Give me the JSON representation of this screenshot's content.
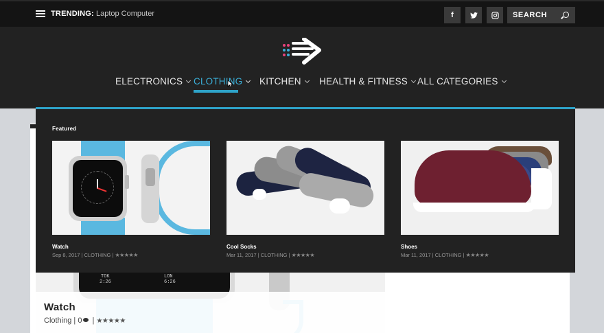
{
  "topbar": {
    "trending_label": "TRENDING:",
    "trending_value": "Laptop Computer",
    "social": [
      "f",
      "t",
      "i"
    ],
    "search_placeholder": "SEARCH"
  },
  "nav": {
    "items": [
      {
        "label": "ELECTRONICS"
      },
      {
        "label": "CLOTHING"
      },
      {
        "label": "KITCHEN"
      },
      {
        "label": "HEALTH & FITNESS"
      },
      {
        "label": "ALL CATEGORIES"
      }
    ],
    "active_index": 1,
    "accent_color": "#2ea3c9"
  },
  "mega": {
    "section_label": "Featured",
    "cards": [
      {
        "title": "Watch",
        "date": "Sep 8, 2017",
        "category": "CLOTHING",
        "stars": "★★★★★"
      },
      {
        "title": "Cool Socks",
        "date": "Mar 11, 2017",
        "category": "CLOTHING",
        "stars": "★★★★★"
      },
      {
        "title": "Shoes",
        "date": "Mar 11, 2017",
        "category": "CLOTHING",
        "stars": "★★★★★"
      }
    ]
  },
  "background_post": {
    "title": "Watch",
    "category": "Clothing",
    "comments": "0",
    "stars": "★★★★★",
    "watch_labels": [
      "TOK",
      "2:26",
      "LON",
      "6:26"
    ]
  }
}
